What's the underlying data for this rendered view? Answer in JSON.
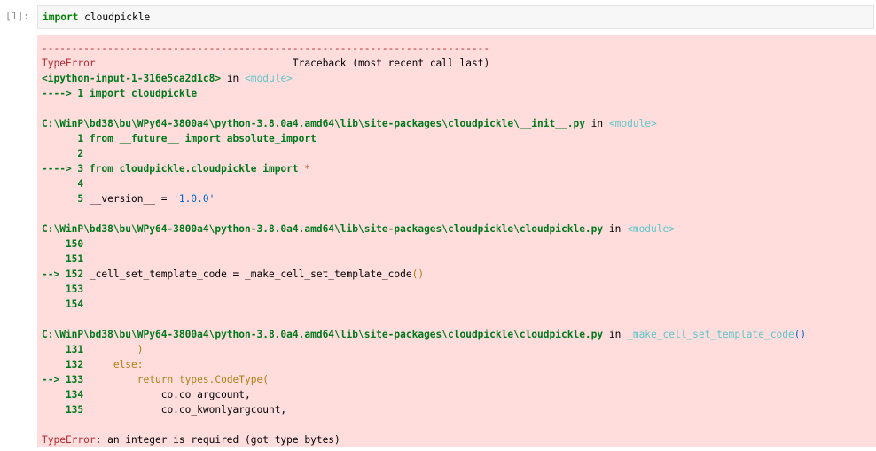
{
  "cell": {
    "prompt": "[1]:",
    "input_kw": "import",
    "input_rest": " cloudpickle"
  },
  "output": {
    "separator": "---------------------------------------------------------------------------",
    "header_err": "TypeError",
    "header_pad": "                                 ",
    "header_tb": "Traceback (most recent call last)",
    "frame1_file": "<ipython-input-1-316e5ca2d1c8>",
    "frame1_in": " in ",
    "frame1_mod": "<module>",
    "frame1_arrow": "----> 1 ",
    "frame1_code": "import cloudpickle",
    "frame2_file": "C:\\WinP\\bd38\\bu\\WPy64-3800a4\\python-3.8.0a4.amd64\\lib\\site-packages\\cloudpickle\\__init__.py",
    "frame2_in": " in ",
    "frame2_mod": "<module>",
    "f2_l1_no": "      1 ",
    "f2_l1_code": "from __future__ import absolute_import",
    "f2_l2_no": "      2",
    "f2_l3_arrow": "----> 3 ",
    "f2_l3_code": "from cloudpickle.cloudpickle import ",
    "f2_l3_star": "*",
    "f2_l4_no": "      4",
    "f2_l5_no": "      5 ",
    "f2_l5_code": "__version__ = ",
    "f2_l5_str": "'1.0.0'",
    "frame3_file": "C:\\WinP\\bd38\\bu\\WPy64-3800a4\\python-3.8.0a4.amd64\\lib\\site-packages\\cloudpickle\\cloudpickle.py",
    "frame3_in": " in ",
    "frame3_mod": "<module>",
    "f3_l150": "    150",
    "f3_l151": "    151",
    "f3_l152_arrow": "--> 152 ",
    "f3_l152_code": "_cell_set_template_code = _make_cell_set_template_code",
    "f3_l152_paren": "()",
    "f3_l153": "    153",
    "f3_l154": "    154",
    "frame4_file": "C:\\WinP\\bd38\\bu\\WPy64-3800a4\\python-3.8.0a4.amd64\\lib\\site-packages\\cloudpickle\\cloudpickle.py",
    "frame4_in": " in ",
    "frame4_func": "_make_cell_set_template_code",
    "frame4_paren": "()",
    "f4_l131_no": "    131 ",
    "f4_l131_code": "        )",
    "f4_l132_no": "    132 ",
    "f4_l132_code": "    else:",
    "f4_l133_arrow": "--> 133 ",
    "f4_l133_ind": "        ",
    "f4_l133_kw": "return",
    "f4_l133_code": " types.CodeType(",
    "f4_l134_no": "    134 ",
    "f4_l134_code": "            co.co_argcount,",
    "f4_l135_no": "    135 ",
    "f4_l135_code": "            co.co_kwonlyargcount,",
    "final_err": "TypeError",
    "final_msg": ": an integer is required (got type bytes)"
  }
}
